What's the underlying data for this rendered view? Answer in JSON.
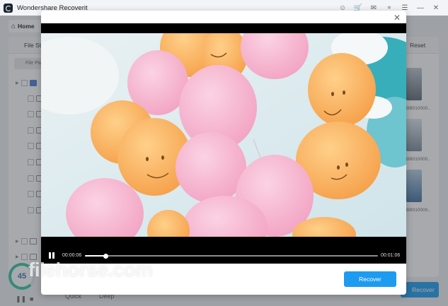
{
  "app": {
    "title": "Wondershare Recoverit",
    "icons": [
      "user-icon",
      "cart-icon",
      "mail-icon",
      "headset-icon",
      "menu-icon",
      "minimize-icon",
      "close-icon"
    ]
  },
  "home_tab": {
    "label": "Home",
    "icon": "home-icon"
  },
  "background": {
    "file_status_label": "File Sta",
    "reset_label": "Reset",
    "file_path_label": "File Pa",
    "thumbnail_labels": [
      "BB010000...",
      "BB010000...",
      "BB010000..."
    ],
    "scan_progress_text": "45",
    "quick_label": "Quick",
    "deep_label": "Deep",
    "recover_label": "Recover"
  },
  "player": {
    "current_time": "00:00:06",
    "total_time": "00:01:06",
    "progress": 0.072
  },
  "modal": {
    "recover_label": "Recover",
    "close_symbol": "✕"
  },
  "watermark": {
    "text": "filehorse.com"
  },
  "colors": {
    "accent": "#1d9bf0",
    "cart": "#e5443a",
    "progress_ring": "#2ec6a0"
  }
}
